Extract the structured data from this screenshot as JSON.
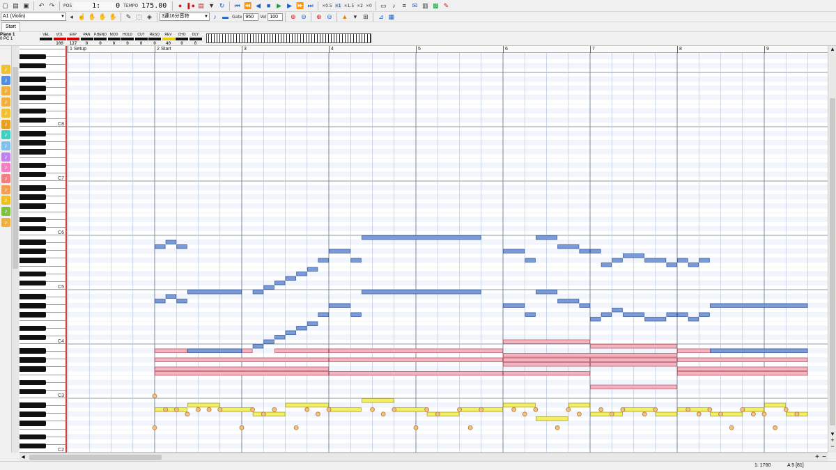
{
  "toolbar": {
    "position": {
      "measure": "1:",
      "beat": "0"
    },
    "tempo": "175.00",
    "pos_label": "POS",
    "tempo_label": "TEMPO",
    "loop_rates": [
      "×0.5",
      "×1",
      "×1.5",
      "×2",
      "×0"
    ],
    "track_selector": "A1 (Violin)",
    "quantize": "3連16分音符",
    "gate_label": "Gate",
    "gate_value": "950",
    "vel_label": "Vel",
    "vel_value": "100"
  },
  "tabs": [
    "Start"
  ],
  "mixer": {
    "track_title": "Piano 1",
    "track_sub": "0   PC   1",
    "cells": [
      {
        "label": "VEL",
        "value": "",
        "color": "#111111"
      },
      {
        "label": "VOL",
        "value": "100",
        "color": "#d00000"
      },
      {
        "label": "EXP",
        "value": "127",
        "color": "#d00000"
      },
      {
        "label": "PAN",
        "value": "0",
        "color": "#111111"
      },
      {
        "label": "P.BEND",
        "value": "0",
        "color": "#111111"
      },
      {
        "label": "MOD",
        "value": "0",
        "color": "#111111"
      },
      {
        "label": "HOLD",
        "value": "0",
        "color": "#111111"
      },
      {
        "label": "CUT",
        "value": "0",
        "color": "#111111"
      },
      {
        "label": "RESO",
        "value": "0",
        "color": "#111111"
      },
      {
        "label": "REV",
        "value": "40",
        "color": "#e8d000"
      },
      {
        "label": "CHO",
        "value": "0",
        "color": "#111111"
      },
      {
        "label": "DLY",
        "value": "0",
        "color": "#111111"
      }
    ]
  },
  "ruler": {
    "markers": [
      {
        "measure": 1,
        "label": "1 Setup"
      },
      {
        "measure": 2,
        "label": "2 Start"
      },
      {
        "measure": 3,
        "label": "3"
      },
      {
        "measure": 4,
        "label": "4"
      },
      {
        "measure": 5,
        "label": "5"
      },
      {
        "measure": 6,
        "label": "6"
      },
      {
        "measure": 7,
        "label": "7"
      },
      {
        "measure": 8,
        "label": "8"
      },
      {
        "measure": 9,
        "label": "9"
      }
    ]
  },
  "keyboard": {
    "octave_labels": [
      "C8",
      "C7",
      "C6",
      "C5",
      "C4",
      "C3",
      "C2"
    ]
  },
  "colors": {
    "melody": "#7b9bd6",
    "melody_border": "#3c5ea8",
    "harmony": "#f4b3bf",
    "harmony_border": "#b8606f",
    "bass": "#f3ef5e",
    "bass_border": "#a8a030",
    "dot": "#f2c080",
    "dot_border": "#b07830",
    "grid_bar": "#788898",
    "grid_beat": "#b8c8dc",
    "grid_row": "#e6eef8"
  },
  "notes": {
    "blue": [
      [
        2.0,
        2.125,
        45
      ],
      [
        2.125,
        2.25,
        46
      ],
      [
        2.25,
        2.375,
        45
      ],
      [
        2.375,
        3.0,
        35
      ],
      [
        3.125,
        3.25,
        35
      ],
      [
        3.25,
        3.375,
        36
      ],
      [
        3.375,
        3.5,
        37
      ],
      [
        3.5,
        3.625,
        38
      ],
      [
        3.625,
        3.75,
        39
      ],
      [
        3.75,
        3.875,
        40
      ],
      [
        3.875,
        4.0,
        42
      ],
      [
        4.0,
        4.25,
        44
      ],
      [
        4.25,
        4.375,
        42
      ],
      [
        4.375,
        5.75,
        47
      ],
      [
        2.0,
        2.125,
        33
      ],
      [
        2.125,
        2.25,
        34
      ],
      [
        2.25,
        2.375,
        33
      ],
      [
        3.125,
        3.25,
        23
      ],
      [
        3.25,
        3.375,
        24
      ],
      [
        3.375,
        3.5,
        25
      ],
      [
        3.5,
        3.625,
        26
      ],
      [
        3.625,
        3.75,
        27
      ],
      [
        3.75,
        3.875,
        28
      ],
      [
        3.875,
        4.0,
        30
      ],
      [
        4.0,
        4.25,
        32
      ],
      [
        4.25,
        4.375,
        30
      ],
      [
        4.375,
        5.75,
        35
      ],
      [
        2.375,
        3.0,
        22
      ],
      [
        6.0,
        6.25,
        44
      ],
      [
        6.25,
        6.375,
        42
      ],
      [
        6.375,
        6.625,
        47
      ],
      [
        6.625,
        6.875,
        45
      ],
      [
        6.875,
        7.0,
        44
      ],
      [
        7.0,
        7.125,
        44
      ],
      [
        7.125,
        7.25,
        41
      ],
      [
        7.25,
        7.375,
        42
      ],
      [
        7.375,
        7.625,
        43
      ],
      [
        7.625,
        7.875,
        42
      ],
      [
        7.875,
        8.0,
        41
      ],
      [
        8.0,
        8.125,
        42
      ],
      [
        8.125,
        8.25,
        41
      ],
      [
        8.25,
        8.375,
        42
      ],
      [
        8.375,
        9.5,
        32
      ],
      [
        6.0,
        6.25,
        32
      ],
      [
        6.25,
        6.375,
        30
      ],
      [
        6.375,
        6.625,
        35
      ],
      [
        6.625,
        6.875,
        33
      ],
      [
        6.875,
        7.0,
        32
      ],
      [
        7.0,
        7.125,
        29
      ],
      [
        7.125,
        7.25,
        30
      ],
      [
        7.25,
        7.375,
        31
      ],
      [
        7.375,
        7.625,
        30
      ],
      [
        7.625,
        7.875,
        29
      ],
      [
        7.875,
        8.0,
        30
      ],
      [
        8.0,
        8.125,
        30
      ],
      [
        8.125,
        8.25,
        29
      ],
      [
        8.25,
        8.375,
        30
      ],
      [
        8.375,
        9.5,
        22
      ]
    ],
    "pink": [
      [
        2.0,
        2.375,
        22
      ],
      [
        2.375,
        3.0,
        22
      ],
      [
        3.0,
        3.125,
        22
      ],
      [
        3.375,
        4.0,
        22
      ],
      [
        4.0,
        6.0,
        22
      ],
      [
        2.0,
        4.0,
        20
      ],
      [
        4.0,
        6.0,
        20
      ],
      [
        2.0,
        4.0,
        18
      ],
      [
        2.0,
        4.0,
        17
      ],
      [
        4.0,
        6.0,
        17
      ],
      [
        6.0,
        7.0,
        24
      ],
      [
        7.0,
        8.0,
        23
      ],
      [
        6.0,
        8.0,
        21
      ],
      [
        6.0,
        7.0,
        20
      ],
      [
        7.0,
        8.0,
        20
      ],
      [
        6.0,
        7.0,
        19
      ],
      [
        7.0,
        8.0,
        19
      ],
      [
        6.0,
        7.0,
        17
      ],
      [
        8.0,
        9.5,
        22
      ],
      [
        8.0,
        9.5,
        20
      ],
      [
        8.0,
        9.5,
        18
      ],
      [
        8.0,
        9.5,
        17
      ],
      [
        7.0,
        8.0,
        14
      ]
    ],
    "yellow": [
      [
        2.0,
        2.375,
        9
      ],
      [
        2.375,
        2.75,
        10
      ],
      [
        2.75,
        3.125,
        9
      ],
      [
        3.125,
        3.5,
        8
      ],
      [
        3.5,
        4.0,
        10
      ],
      [
        4.0,
        4.375,
        9
      ],
      [
        4.375,
        4.75,
        11
      ],
      [
        4.75,
        5.125,
        9
      ],
      [
        5.125,
        5.5,
        8
      ],
      [
        5.5,
        6.0,
        9
      ],
      [
        6.0,
        6.375,
        10
      ],
      [
        6.375,
        6.75,
        7
      ],
      [
        6.75,
        7.0,
        10
      ],
      [
        7.0,
        7.375,
        8
      ],
      [
        7.375,
        7.75,
        9
      ],
      [
        7.75,
        8.0,
        8
      ],
      [
        8.0,
        8.375,
        9
      ],
      [
        8.375,
        8.75,
        8
      ],
      [
        8.75,
        9.0,
        9
      ],
      [
        9.0,
        9.25,
        10
      ],
      [
        9.25,
        9.5,
        8
      ]
    ],
    "dots": [
      [
        2.0,
        12
      ],
      [
        2.0,
        5
      ],
      [
        2.125,
        9
      ],
      [
        2.25,
        9
      ],
      [
        2.375,
        8
      ],
      [
        2.5,
        9
      ],
      [
        2.625,
        9
      ],
      [
        2.75,
        9
      ],
      [
        3.0,
        5
      ],
      [
        3.125,
        9
      ],
      [
        3.25,
        8
      ],
      [
        3.375,
        9
      ],
      [
        3.625,
        5
      ],
      [
        3.75,
        9
      ],
      [
        3.875,
        8
      ],
      [
        4.0,
        9
      ],
      [
        4.5,
        9
      ],
      [
        4.625,
        8
      ],
      [
        4.75,
        9
      ],
      [
        5.0,
        5
      ],
      [
        5.125,
        9
      ],
      [
        5.25,
        8
      ],
      [
        5.5,
        9
      ],
      [
        5.625,
        5
      ],
      [
        5.75,
        9
      ],
      [
        6.125,
        9
      ],
      [
        6.25,
        8
      ],
      [
        6.375,
        9
      ],
      [
        6.625,
        5
      ],
      [
        6.75,
        9
      ],
      [
        6.875,
        8
      ],
      [
        7.125,
        9
      ],
      [
        7.25,
        8
      ],
      [
        7.375,
        9
      ],
      [
        7.625,
        8
      ],
      [
        7.75,
        9
      ],
      [
        8.125,
        9
      ],
      [
        8.25,
        8
      ],
      [
        8.375,
        9
      ],
      [
        8.5,
        8
      ],
      [
        8.625,
        5
      ],
      [
        8.75,
        9
      ],
      [
        8.875,
        8
      ],
      [
        9.0,
        8
      ],
      [
        9.125,
        5
      ],
      [
        9.25,
        9
      ],
      [
        9.375,
        8
      ]
    ]
  },
  "status": {
    "position": "1: 1760",
    "note": "A 5 [81]"
  }
}
